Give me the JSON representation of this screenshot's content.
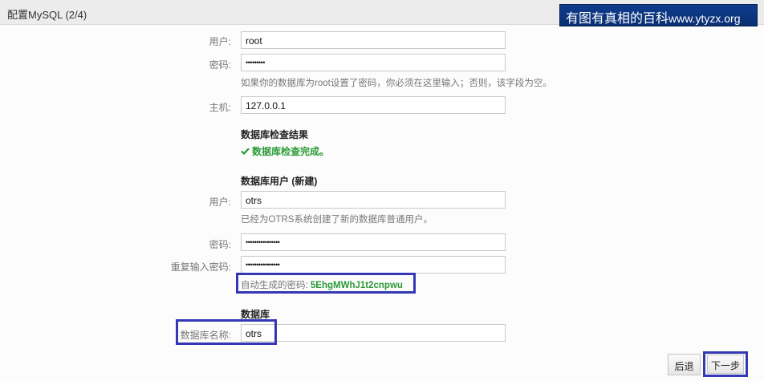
{
  "header": {
    "title": "配置MySQL (2/4)"
  },
  "watermark": {
    "text": "有图有真相的百科",
    "url": "www.ytyzx.org"
  },
  "admin": {
    "user_label": "用户:",
    "user_value": "root",
    "password_label": "密码:",
    "password_value": "•••••••••",
    "hint": "如果你的数据库为root设置了密码，你必须在这里输入；否则，该字段为空。"
  },
  "host": {
    "label": "主机:",
    "value": "127.0.0.1"
  },
  "check": {
    "title": "数据库检查结果",
    "status": "数据库检查完成。",
    "status_icon": "check-icon"
  },
  "db_user": {
    "title": "数据库用户 (新建)",
    "user_label": "用户:",
    "user_value": "otrs",
    "user_hint": "已经为OTRS系统创建了新的数据库普通用户。",
    "password_label": "密码:",
    "password_value": "••••••••••••••••",
    "repeat_label": "重复输入密码:",
    "repeat_value": "••••••••••••••••",
    "generated_label": "自动生成的密码:",
    "generated_value": "5EhgMWhJ1t2cnpwu"
  },
  "database": {
    "title": "数据库",
    "name_label": "数据库名称:",
    "name_value": "otrs"
  },
  "buttons": {
    "back": "后退",
    "next": "下一步"
  },
  "colors": {
    "highlight": "#3438b4",
    "success": "#2a9a36",
    "watermark": "#0e3c8e"
  }
}
